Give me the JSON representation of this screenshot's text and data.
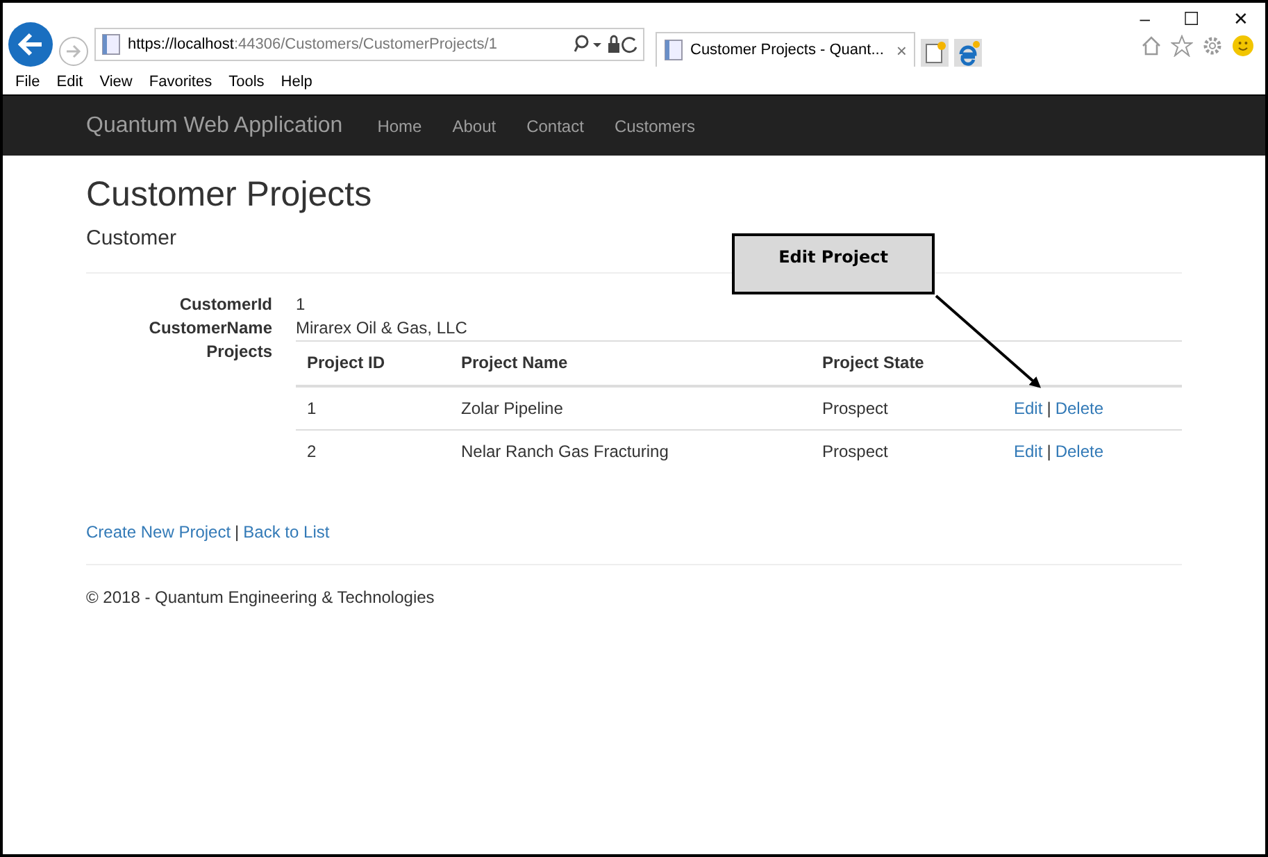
{
  "browser": {
    "url_host": "https://localhost",
    "url_path": ":44306/Customers/CustomerProjects/1",
    "tab_title": "Customer Projects - Quant...",
    "tab_close": "×",
    "window_controls": [
      "–",
      "☐",
      "✕"
    ],
    "menu": [
      "File",
      "Edit",
      "View",
      "Favorites",
      "Tools",
      "Help"
    ]
  },
  "navbar": {
    "brand": "Quantum Web Application",
    "links": [
      "Home",
      "About",
      "Contact",
      "Customers"
    ]
  },
  "page": {
    "title": "Customer Projects",
    "subtitle": "Customer",
    "fields": [
      {
        "label": "CustomerId",
        "value": "1"
      },
      {
        "label": "CustomerName",
        "value": "Mirarex Oil & Gas, LLC"
      }
    ],
    "projects_label": "Projects",
    "table": {
      "columns": [
        "Project ID",
        "Project Name",
        "Project State"
      ],
      "rows": [
        {
          "id": "1",
          "name": "Zolar Pipeline",
          "state": "Prospect",
          "edit": "Edit",
          "separator": "|",
          "delete": "Delete"
        },
        {
          "id": "2",
          "name": "Nelar Ranch Gas Fracturing",
          "state": "Prospect",
          "edit": "Edit",
          "separator": "|",
          "delete": "Delete"
        }
      ]
    },
    "links": {
      "create": "Create New Project",
      "separator": "|",
      "back": "Back to List"
    },
    "footer": "© 2018 - Quantum Engineering & Technologies"
  },
  "callout": {
    "text": "Edit Project"
  }
}
